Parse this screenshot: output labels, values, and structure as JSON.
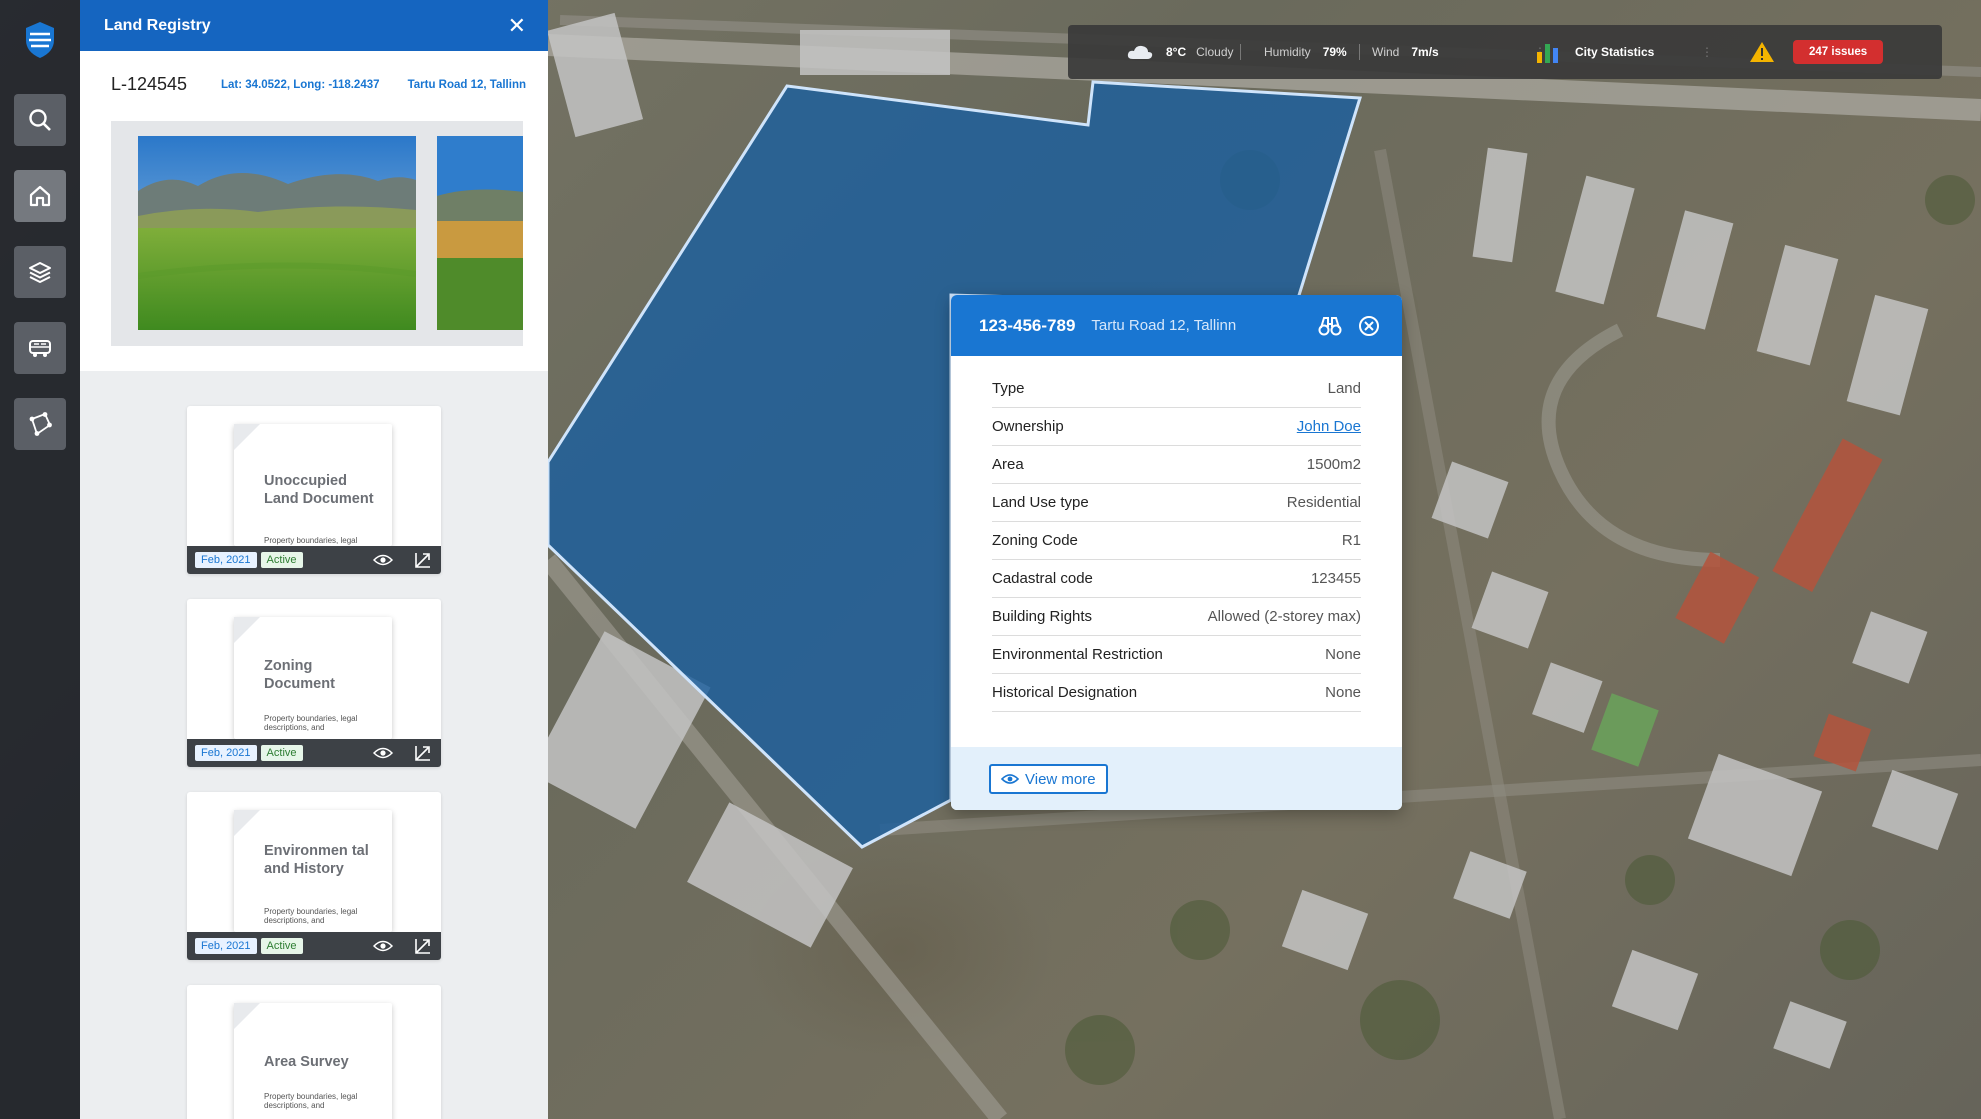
{
  "panel": {
    "title": "Land Registry",
    "close_icon": "close-icon",
    "registry_id": "L-124545",
    "coordinates": "Lat: 34.0522, Long: -118.2437",
    "address": "Tartu Road 12, Tallinn"
  },
  "documents": [
    {
      "title": "Unoccupied Land Document",
      "description": "Property boundaries, legal descriptions, and",
      "date": "Feb, 2021",
      "status": "Active"
    },
    {
      "title": "Zoning Document",
      "description": "Property boundaries, legal descriptions, and",
      "date": "Feb, 2021",
      "status": "Active"
    },
    {
      "title": "Environmen tal and History",
      "description": "Property boundaries, legal descriptions, and",
      "date": "Feb, 2021",
      "status": "Active"
    },
    {
      "title": "Area Survey",
      "description": "Property boundaries, legal descriptions, and",
      "date": "",
      "status": ""
    }
  ],
  "rail": {
    "items": [
      "search-icon",
      "home-icon",
      "layers-icon",
      "vehicle-icon",
      "polygon-draw-icon"
    ]
  },
  "statusbar": {
    "temperature": "8°C",
    "condition": "Cloudy",
    "humidity_label": "Humidity",
    "humidity_value": "79%",
    "wind_label": "Wind",
    "wind_value": "7m/s",
    "stats_label": "City Statistics",
    "issues_label": "247 issues"
  },
  "popup": {
    "parcel_id": "123-456-789",
    "address": "Tartu Road 12, Tallinn",
    "rows": [
      {
        "key": "Type",
        "value": "Land"
      },
      {
        "key": "Ownership",
        "value": "John Doe"
      },
      {
        "key": "Area",
        "value": "1500m2"
      },
      {
        "key": "Land Use type",
        "value": "Residential"
      },
      {
        "key": "Zoning Code",
        "value": "R1"
      },
      {
        "key": "Cadastral code",
        "value": "123455"
      },
      {
        "key": "Building Rights",
        "value": "Allowed (2-storey max)"
      },
      {
        "key": "Environmental Restriction",
        "value": "None"
      },
      {
        "key": "Historical Designation",
        "value": "None"
      }
    ],
    "view_more_label": "View more"
  },
  "colors": {
    "primary": "#1976d2",
    "panel_header": "#1565c0",
    "parcel_fill": "#1c5f9e",
    "issues": "#d32f2f",
    "active_tag": "#2e7d32"
  }
}
